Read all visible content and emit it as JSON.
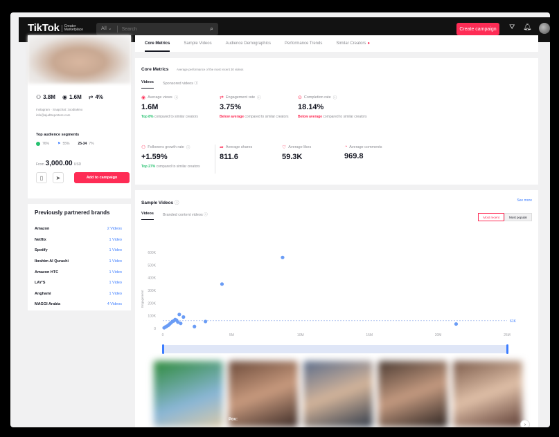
{
  "header": {
    "logo_main": "TikTok",
    "logo_sub_1": "Creator",
    "logo_sub_2": "Marketplace",
    "search_scope": "All",
    "search_placeholder": "Search",
    "create_campaign": "Create campaign"
  },
  "profile": {
    "followers": "3.8M",
    "views": "1.6M",
    "engagement": "4%",
    "socials_line1": "Instagram · Snapchat: zoodiakmo",
    "socials_line2": "info@ajudtreporters.com",
    "top_segments_title": "Top audience segments",
    "segments": [
      {
        "label": "76%"
      },
      {
        "label": "55%"
      },
      {
        "label": "25-34",
        "pct": "7%"
      }
    ],
    "price_from": "From",
    "price": "3,000.00",
    "currency": "USD",
    "add_to_campaign": "Add to campaign"
  },
  "brands": {
    "title": "Previously partnered brands",
    "items": [
      {
        "name": "Amazon",
        "videos": "2 Videos"
      },
      {
        "name": "Netflix",
        "videos": "1 Video"
      },
      {
        "name": "Spotify",
        "videos": "1 Video"
      },
      {
        "name": "Ibrahim Al Qurashi",
        "videos": "1 Video"
      },
      {
        "name": "Amazon HTC",
        "videos": "1 Video"
      },
      {
        "name": "LAY'S",
        "videos": "1 Video"
      },
      {
        "name": "Anghami",
        "videos": "1 Video"
      },
      {
        "name": "MAGGI Arabia",
        "videos": "4 Videos"
      }
    ]
  },
  "tabs": [
    "Core Metrics",
    "Sample Videos",
    "Audience Demographics",
    "Performance Trends",
    "Similar Creators"
  ],
  "core": {
    "title": "Core Metrics",
    "subtitle": "Average performance of the most recent 30 videos",
    "subtabs": [
      "Videos",
      "Sponsored videos"
    ],
    "metrics": [
      {
        "label": "Average views",
        "value": "1.6M",
        "note_strong": "Top 8%",
        "note_rest": "compared to similar creators",
        "tone": "up"
      },
      {
        "label": "Engagement rate",
        "value": "3.75%",
        "note_strong": "Below average",
        "note_rest": "compared to similar creators",
        "tone": "down"
      },
      {
        "label": "Completion rate",
        "value": "18.14%",
        "note_strong": "Below average",
        "note_rest": "compared to similar creators",
        "tone": "down"
      },
      {
        "label": "Followers growth rate",
        "value": "+1.59%",
        "note_strong": "Top 27%",
        "note_rest": "compared to similar creators",
        "tone": "up"
      },
      {
        "label": "Average shares",
        "value": "811.6"
      },
      {
        "label": "Average likes",
        "value": "59.3K"
      },
      {
        "label": "Average comments",
        "value": "969.8"
      }
    ]
  },
  "sample": {
    "title": "Sample Videos",
    "see_more": "See more",
    "subtabs": [
      "Videos",
      "Branded content videos"
    ],
    "toggle_on": "Most recent",
    "toggle_off": "Most popular",
    "overlay_text": "Pov:"
  },
  "chart_data": {
    "type": "scatter",
    "xlabel": "",
    "ylabel": "Engagement",
    "x_ticks": [
      "0",
      "5M",
      "10M",
      "15M",
      "20M",
      "25M"
    ],
    "y_ticks": [
      "0",
      "100K",
      "200K",
      "300K",
      "400K",
      "500K",
      "600K"
    ],
    "xlim": [
      0,
      25000000
    ],
    "ylim": [
      0,
      600000
    ],
    "avg_line": 61000,
    "avg_label": "61K",
    "points": [
      [
        100000,
        5000
      ],
      [
        200000,
        12000
      ],
      [
        300000,
        18000
      ],
      [
        400000,
        25000
      ],
      [
        500000,
        35000
      ],
      [
        600000,
        45000
      ],
      [
        700000,
        55000
      ],
      [
        800000,
        60000
      ],
      [
        900000,
        70000
      ],
      [
        1000000,
        65000
      ],
      [
        1100000,
        50000
      ],
      [
        1300000,
        40000
      ],
      [
        1200000,
        110000
      ],
      [
        1500000,
        90000
      ],
      [
        2300000,
        15000
      ],
      [
        3100000,
        55000
      ],
      [
        4300000,
        350000
      ],
      [
        8700000,
        560000
      ],
      [
        21300000,
        35000
      ]
    ]
  },
  "colors": {
    "accent": "#fe2c55",
    "link": "#3b7cff",
    "positive": "#25c16f",
    "point": "#6a9cf5"
  }
}
